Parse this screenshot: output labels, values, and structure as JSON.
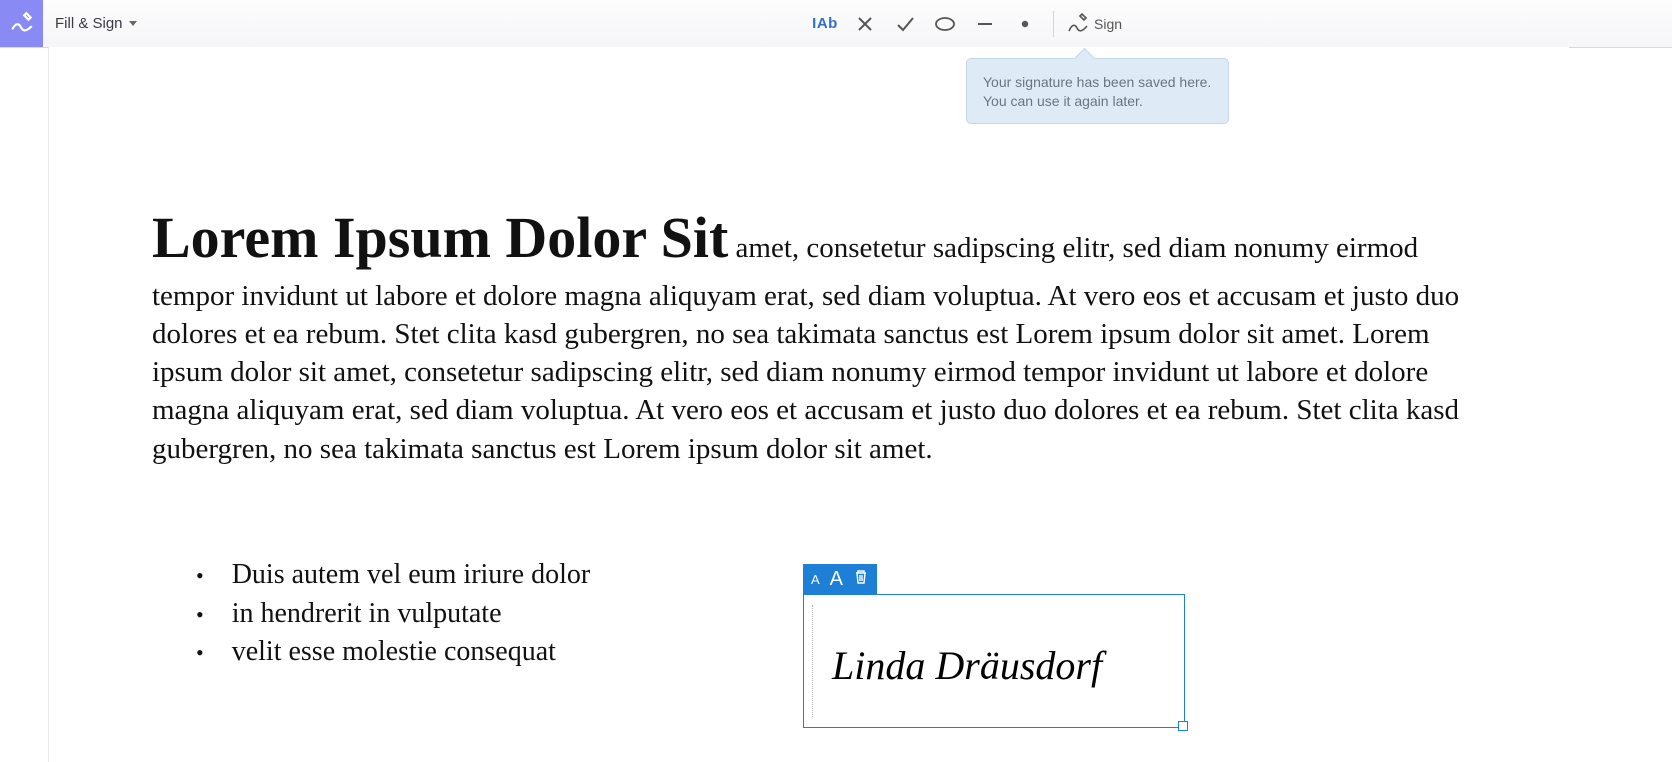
{
  "toolbar": {
    "fill_sign_label": "Fill & Sign",
    "text_tool_label": "IAb",
    "sign_label": "Sign"
  },
  "tooltip": {
    "text": "Your signature has been saved here. You can use it again later."
  },
  "document": {
    "title": "Lorem Ipsum Dolor Sit",
    "body_lead": " amet, consetetur sadipscing elitr, sed diam ",
    "body_rest": "nonumy eirmod tempor invidunt ut labore et dolore magna aliquyam erat, sed diam voluptua. At vero eos et accusam et justo duo dolores et ea rebum. Stet clita kasd gubergren, no sea takimata sanctus est Lorem ipsum dolor sit amet. Lorem ipsum dolor sit amet, consetetur sadipscing elitr, sed diam nonumy eirmod tempor invidunt ut labore et dolore magna aliquyam erat, sed diam voluptua. At vero eos et accusam et justo duo dolores et ea rebum. Stet clita kasd gubergren, no sea takimata sanctus est Lorem ipsum dolor sit amet.",
    "bullets": [
      "Duis autem vel eum iriure dolor",
      "in hendrerit in vulputate",
      "velit esse molestie consequat"
    ]
  },
  "signature": {
    "name": "Linda Dräusdorf",
    "small_a": "A",
    "big_a": "A"
  }
}
